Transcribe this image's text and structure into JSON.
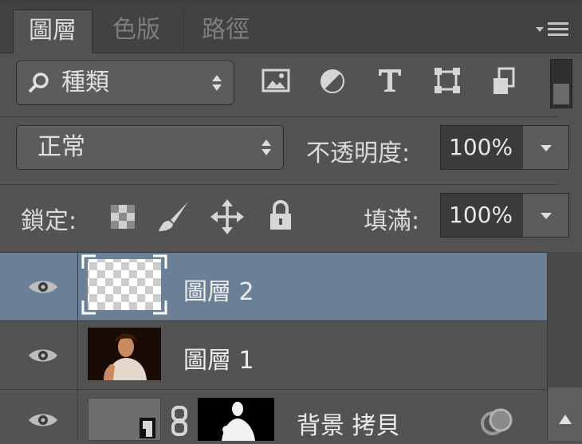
{
  "tabs": [
    {
      "label": "圖層",
      "active": true
    },
    {
      "label": "色版",
      "active": false
    },
    {
      "label": "路徑",
      "active": false
    }
  ],
  "panel_menu_icon": "panel-menu-icon",
  "filter": {
    "kind_label": "種類",
    "icons": [
      "image-filter-icon",
      "adjustment-filter-icon",
      "type-filter-icon",
      "shape-filter-icon",
      "smart-object-filter-icon",
      "filter-toggle-switch"
    ]
  },
  "blend": {
    "mode": "正常",
    "opacity_label": "不透明度:",
    "opacity_value": "100%"
  },
  "lock": {
    "label": "鎖定:",
    "icons": [
      "lock-transparent-pixels-icon",
      "lock-image-pixels-icon",
      "lock-position-icon",
      "lock-all-icon"
    ],
    "fill_label": "填滿:",
    "fill_value": "100%"
  },
  "layers": [
    {
      "name": "圖層 2",
      "selected": true,
      "visible": true
    },
    {
      "name": "圖層 1",
      "selected": false,
      "visible": true
    },
    {
      "name": "背景 拷貝",
      "selected": false,
      "visible": true
    }
  ],
  "colors": {
    "panel_bg": "#535353",
    "selected_row": "#6b8097",
    "tab_bar": "#424242"
  }
}
